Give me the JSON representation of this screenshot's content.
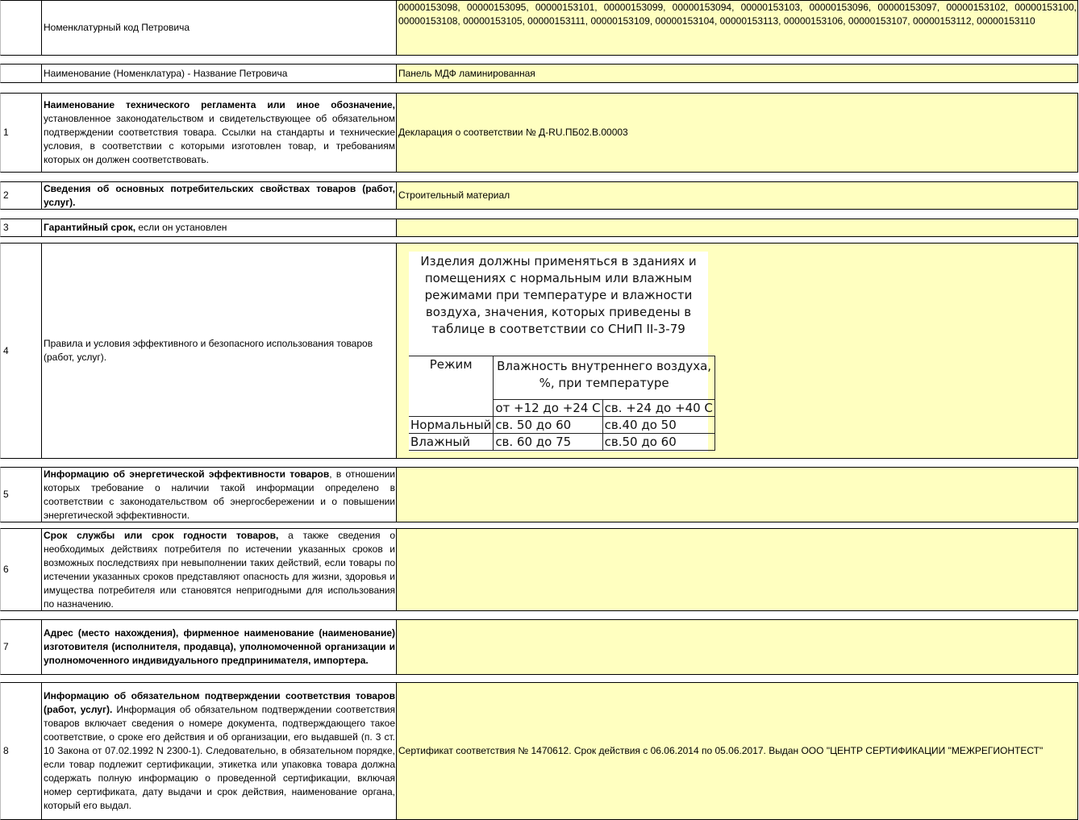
{
  "rows": {
    "code": {
      "name": "Номенклатурный код Петровича",
      "value": "00000153098, 00000153095, 00000153101, 00000153099, 00000153094, 00000153103, 00000153096, 00000153097, 00000153102, 00000153100, 00000153108, 00000153105, 00000153111, 00000153109, 00000153104, 00000153113, 00000153106, 00000153107, 00000153112, 00000153110"
    },
    "title": {
      "name": "Наименование (Номенклатура) - Название Петровича",
      "value": "Панель МДФ ламинированная"
    },
    "r1": {
      "num": "1",
      "name_bold": "Наименование технического регламента или иное обозначение,",
      "name_rest": " установленное законодательством и свидетельствующее об обязательном подтверждении соответствия товара. Ссылки на стандарты и технические условия, в соответствии с которыми изготовлен товар, и требованиям которых он должен соответствовать.",
      "value": "Декларация о соответствии  № Д-RU.ПБ02.В.00003"
    },
    "r2": {
      "num": "2",
      "name_bold": "Сведения об основных потребительских свойствах товаров (работ, услуг).",
      "value": "Строительный материал"
    },
    "r3": {
      "num": "3",
      "name_bold": "Гарантийный срок,",
      "name_rest": " если он установлен",
      "value": ""
    },
    "r4": {
      "num": "4",
      "name": "Правила и условия эффективного и безопасного использования товаров (работ, услуг).",
      "picture": {
        "heading": [
          "Изделия должны применяться в зданиях и",
          "помещениях с нормальным или влажным",
          "режимами при температуре и влажности",
          "воздуха, значения, которых приведены в",
          "таблице в соответствии со СНиП II-3-79"
        ],
        "col_mode": "Режим",
        "col_humidity": "Влажность внутреннего воздуха, %, при температуре",
        "temp1": "от +12 до +24 С",
        "temp2": "св. +24 до +40 С",
        "rows": [
          {
            "mode": "Нормальный",
            "v1": "св. 50 до 60",
            "v2": "св.40 до 50"
          },
          {
            "mode": "Влажный",
            "v1": "св. 60 до 75",
            "v2": "св.50 до 60"
          }
        ]
      }
    },
    "r5": {
      "num": "5",
      "name_bold": "Информацию об энергетической эффективности товаров",
      "name_rest": ", в отношении которых требование о наличии такой информации определено в соответствии с законодательством об энергосбережении и о повышении энергетической эффективности.",
      "value": ""
    },
    "r6": {
      "num": "6",
      "name_bold": "Срок службы или срок годности товаров,",
      "name_rest": " а также сведения о необходимых действиях потребителя по истечении указанных сроков и возможных последствиях при невыполнении таких действий, если товары по истечении указанных сроков представляют опасность для жизни, здоровья и имущества потребителя или становятся непригодными для использования по назначению.",
      "value": ""
    },
    "r7": {
      "num": "7",
      "name_bold": "Адрес (место нахождения), фирменное наименование (наименование) изготовителя (исполнителя, продавца), уполномоченной организации и уполномоченного индивидуального предпринимателя, импортера.",
      "value": ""
    },
    "r8": {
      "num": "8",
      "name_bold": "Информацию об обязательном подтверждении соответствия товаров (работ, услуг).",
      "name_rest": " Информация об обязательном подтверждении соответствия товаров включает сведения о номере документа, подтверждающего такое соответствие, о сроке его действия и об организации, его выдавшей (п. 3 ст. 10 Закона от 07.02.1992 N 2300-1). Следовательно, в обязательном порядке, если товар подлежит сертификации, этикетка или упаковка товара должна содержать полную информацию о проведенной сертификации, включая номер сертификата, дату выдачи и срок действия, наименование органа, который его выдал.",
      "value": "Сертификат соответствия № 1470612. Срок действия с 06.06.2014 по 05.06.2017. Выдан ООО \"ЦЕНТР СЕРТИФИКАЦИИ \"МЕЖРЕГИОНТЕСТ\""
    }
  }
}
